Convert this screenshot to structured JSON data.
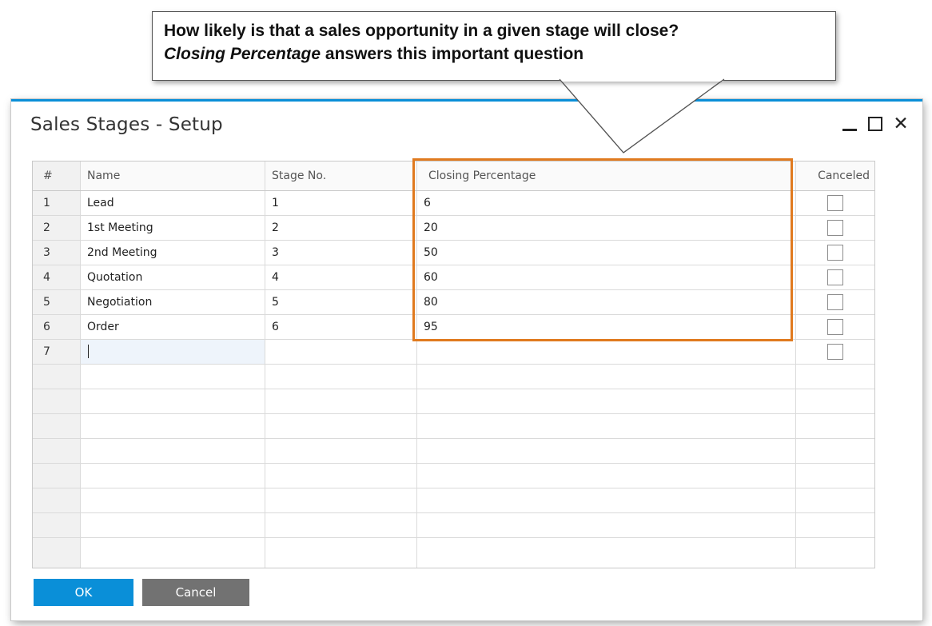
{
  "callout": {
    "line1": "How likely is that a sales opportunity in a given stage will close?",
    "line2_italic": "Closing Percentage",
    "line2_rest": " answers this important question"
  },
  "window": {
    "title": "Sales Stages - Setup",
    "accent_color": "#0a8fd8"
  },
  "grid": {
    "columns": [
      "#",
      "Name",
      "Stage No.",
      "Closing Percentage",
      "Canceled"
    ],
    "rows": [
      {
        "num": "1",
        "name": "Lead",
        "stage": "1",
        "pct": "6"
      },
      {
        "num": "2",
        "name": "1st Meeting",
        "stage": "2",
        "pct": "20"
      },
      {
        "num": "3",
        "name": "2nd Meeting",
        "stage": "3",
        "pct": "50"
      },
      {
        "num": "4",
        "name": "Quotation",
        "stage": "4",
        "pct": "60"
      },
      {
        "num": "5",
        "name": "Negotiation",
        "stage": "5",
        "pct": "80"
      },
      {
        "num": "6",
        "name": "Order",
        "stage": "6",
        "pct": "95"
      },
      {
        "num": "7",
        "name": "",
        "stage": "",
        "pct": ""
      }
    ],
    "highlight_color": "#e07a1f"
  },
  "buttons": {
    "ok_label": "OK",
    "cancel_label": "Cancel"
  }
}
